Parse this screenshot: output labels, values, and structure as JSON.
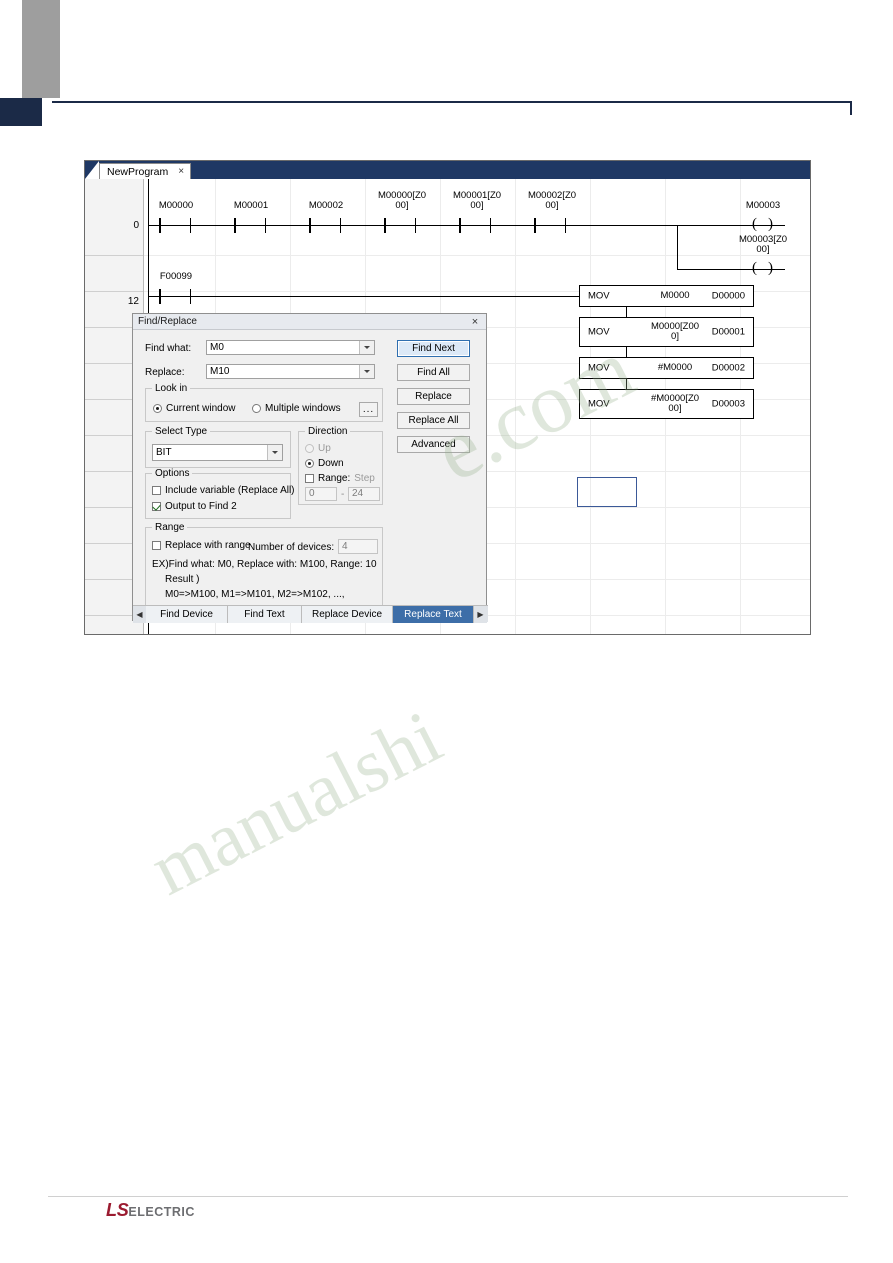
{
  "document": {
    "footer_brand_ls": "LS",
    "footer_brand_electric": "ELECTRIC"
  },
  "watermark": {
    "line1": "e.com",
    "line2": "manualshi"
  },
  "editor": {
    "tab_label": "NewProgram",
    "tab_close_icon": "×",
    "rung_numbers": [
      "0",
      "12"
    ],
    "rung0": {
      "contacts": [
        {
          "label": "M00000"
        },
        {
          "label": "M00001"
        },
        {
          "label": "M00002"
        },
        {
          "label": "M00000[Z0\n00]"
        },
        {
          "label": "M00001[Z0\n00]"
        },
        {
          "label": "M00002[Z0\n00]"
        }
      ],
      "coils": [
        {
          "label": "M00003"
        },
        {
          "label": "M00003[Z0\n00]"
        }
      ]
    },
    "rung12": {
      "contact": "F00099",
      "blocks": [
        {
          "op": "MOV",
          "arg1": "M0000",
          "arg2": "D00000"
        },
        {
          "op": "MOV",
          "arg1": "M0000[Z00\n0]",
          "arg2": "D00001"
        },
        {
          "op": "MOV",
          "arg1": "#M0000",
          "arg2": "D00002"
        },
        {
          "op": "MOV",
          "arg1": "#M0000[Z0\n00]",
          "arg2": "D00003"
        }
      ]
    }
  },
  "dialog": {
    "title": "Find/Replace",
    "close_icon": "×",
    "find_what_label": "Find what:",
    "find_what_value": "M0",
    "replace_label": "Replace:",
    "replace_value": "M10",
    "look_in": {
      "title": "Look in",
      "option_current": "Current window",
      "option_multiple": "Multiple windows",
      "browse_label": "..."
    },
    "select_type": {
      "title": "Select Type",
      "value": "BIT"
    },
    "direction": {
      "title": "Direction",
      "up_label": "Up",
      "down_label": "Down",
      "range_label": "Range:",
      "step_label": "Step",
      "range_from": "0",
      "range_dash": "-",
      "range_to": "24"
    },
    "options": {
      "title": "Options",
      "include_variable": "Include variable (Replace All)",
      "output_to_find2": "Output to Find 2"
    },
    "range": {
      "title": "Range",
      "replace_with_range": "Replace with range",
      "number_of_devices_label": "Number of devices:",
      "number_of_devices_value": "4",
      "example_line1": "EX)Find what: M0, Replace with: M100, Range: 10",
      "example_line2": "Result )",
      "example_line3": "M0=>M100, M1=>M101, M2=>M102, ...,"
    },
    "buttons": {
      "find_next": "Find Next",
      "find_all": "Find All",
      "replace": "Replace",
      "replace_all": "Replace All",
      "advanced": "Advanced"
    },
    "tabs": {
      "prev_icon": "◀",
      "next_icon": "▶",
      "items": [
        {
          "label": "Find Device",
          "active": false
        },
        {
          "label": "Find Text",
          "active": false
        },
        {
          "label": "Replace Device",
          "active": false
        },
        {
          "label": "Replace Text",
          "active": true
        }
      ]
    }
  },
  "colors": {
    "accent": "#1f3864",
    "tab_active": "#3d6ea8",
    "primary_button": "#dce9f7",
    "brand_red": "#9b1b30"
  }
}
